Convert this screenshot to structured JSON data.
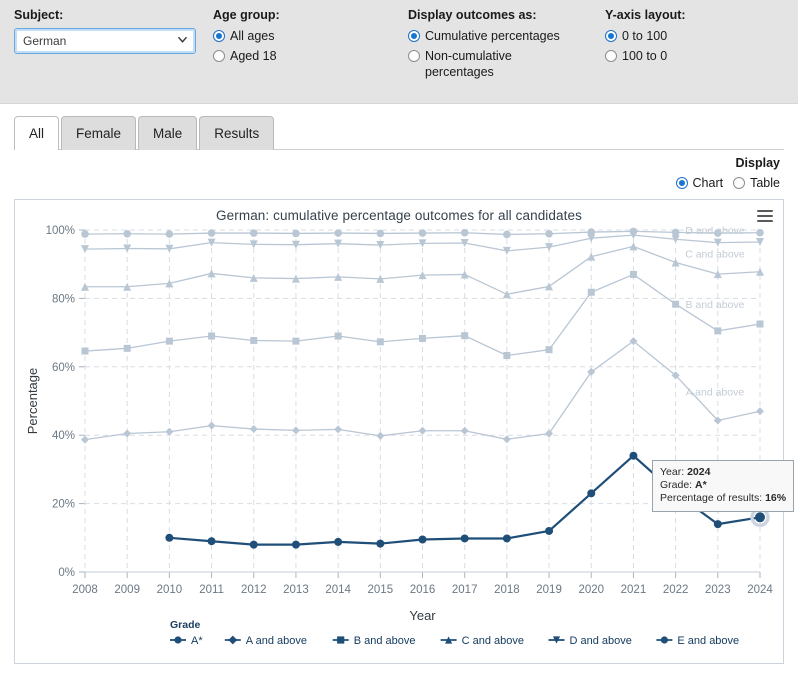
{
  "controls": {
    "subject": {
      "label": "Subject:",
      "value": "German",
      "options": [
        "German"
      ]
    },
    "age_group": {
      "label": "Age group:",
      "options": [
        {
          "label": "All ages",
          "selected": true
        },
        {
          "label": "Aged 18",
          "selected": false
        }
      ]
    },
    "display_outcomes": {
      "label": "Display outcomes as:",
      "options": [
        {
          "label": "Cumulative percentages",
          "selected": true
        },
        {
          "label": "Non-cumulative percentages",
          "selected": false
        }
      ]
    },
    "yaxis_layout": {
      "label": "Y-axis layout:",
      "options": [
        {
          "label": "0 to 100",
          "selected": true
        },
        {
          "label": "100 to 0",
          "selected": false
        }
      ]
    }
  },
  "tabs": [
    {
      "label": "All",
      "active": true
    },
    {
      "label": "Female",
      "active": false
    },
    {
      "label": "Male",
      "active": false
    },
    {
      "label": "Results",
      "active": false
    }
  ],
  "display": {
    "title": "Display",
    "options": [
      {
        "label": "Chart",
        "selected": true
      },
      {
        "label": "Table",
        "selected": false
      }
    ]
  },
  "chart_menu_icon": "hamburger-menu-icon",
  "tooltip": {
    "year_label": "Year:",
    "year_value": "2024",
    "grade_label": "Grade:",
    "grade_value": "A*",
    "percent_label": "Percentage of results:",
    "percent_value": "16%"
  },
  "colors": {
    "accent": "#1675d1",
    "panel_bg": "#e4e4e4",
    "series_active": "#1f4e79",
    "series_faded": "#b9c6d4",
    "grid": "#d8dde3"
  },
  "chart_data": {
    "type": "line",
    "title": "German: cumulative percentage outcomes for all candidates",
    "xlabel": "Year",
    "ylabel": "Percentage",
    "ylim": [
      0,
      100
    ],
    "ytick_labels": [
      "0%",
      "20%",
      "40%",
      "60%",
      "80%",
      "100%"
    ],
    "yticks": [
      0,
      20,
      40,
      60,
      80,
      100
    ],
    "grid": true,
    "legend_title": "Grade",
    "legend_position": "bottom",
    "x": [
      2008,
      2009,
      2010,
      2011,
      2012,
      2013,
      2014,
      2015,
      2016,
      2017,
      2018,
      2019,
      2020,
      2021,
      2022,
      2023,
      2024
    ],
    "series": [
      {
        "name": "A*",
        "marker": "circle",
        "highlighted": true,
        "x": [
          2010,
          2011,
          2012,
          2013,
          2014,
          2015,
          2016,
          2017,
          2018,
          2019,
          2020,
          2021,
          2022,
          2023,
          2024
        ],
        "values": [
          10.0,
          9.0,
          8.0,
          8.0,
          8.8,
          8.3,
          9.5,
          9.8,
          9.8,
          12.0,
          23.0,
          34.0,
          23.0,
          14.0,
          16.0
        ]
      },
      {
        "name": "A and above",
        "marker": "diamond",
        "highlighted": false,
        "values": [
          38.7,
          40.5,
          41.0,
          42.8,
          41.8,
          41.4,
          41.7,
          39.8,
          41.3,
          41.3,
          38.8,
          40.5,
          58.5,
          67.5,
          57.5,
          44.3,
          47.0
        ]
      },
      {
        "name": "B and above",
        "marker": "square",
        "highlighted": false,
        "values": [
          64.6,
          65.4,
          67.5,
          69.0,
          67.7,
          67.5,
          69.0,
          67.3,
          68.3,
          69.1,
          63.3,
          65.0,
          81.8,
          87.0,
          78.3,
          70.5,
          72.5
        ]
      },
      {
        "name": "C and above",
        "marker": "triangle",
        "highlighted": false,
        "values": [
          83.4,
          83.4,
          84.4,
          87.3,
          86.0,
          85.8,
          86.3,
          85.7,
          86.8,
          87.0,
          81.2,
          83.5,
          92.2,
          95.2,
          90.5,
          87.1,
          87.8
        ]
      },
      {
        "name": "D and above",
        "marker": "triangle-down",
        "highlighted": false,
        "values": [
          94.4,
          94.6,
          94.5,
          96.3,
          95.8,
          95.7,
          96.0,
          95.6,
          96.1,
          96.2,
          93.9,
          95.0,
          97.6,
          98.5,
          97.3,
          96.3,
          96.5
        ]
      },
      {
        "name": "E and above",
        "marker": "circle",
        "highlighted": false,
        "values": [
          98.8,
          98.9,
          98.8,
          99.1,
          99.1,
          99.0,
          99.1,
          99.0,
          99.1,
          99.2,
          98.7,
          98.9,
          99.4,
          99.6,
          99.3,
          99.1,
          99.2
        ]
      }
    ],
    "inline_series_labels": [
      {
        "text": "E and above",
        "series": "E and above"
      },
      {
        "text": "D and above",
        "series": "D and above"
      },
      {
        "text": "C and above",
        "series": "C and above"
      },
      {
        "text": "B and above",
        "series": "B and above"
      },
      {
        "text": "A and above",
        "series": "A and above"
      }
    ],
    "point_label": "A*"
  }
}
